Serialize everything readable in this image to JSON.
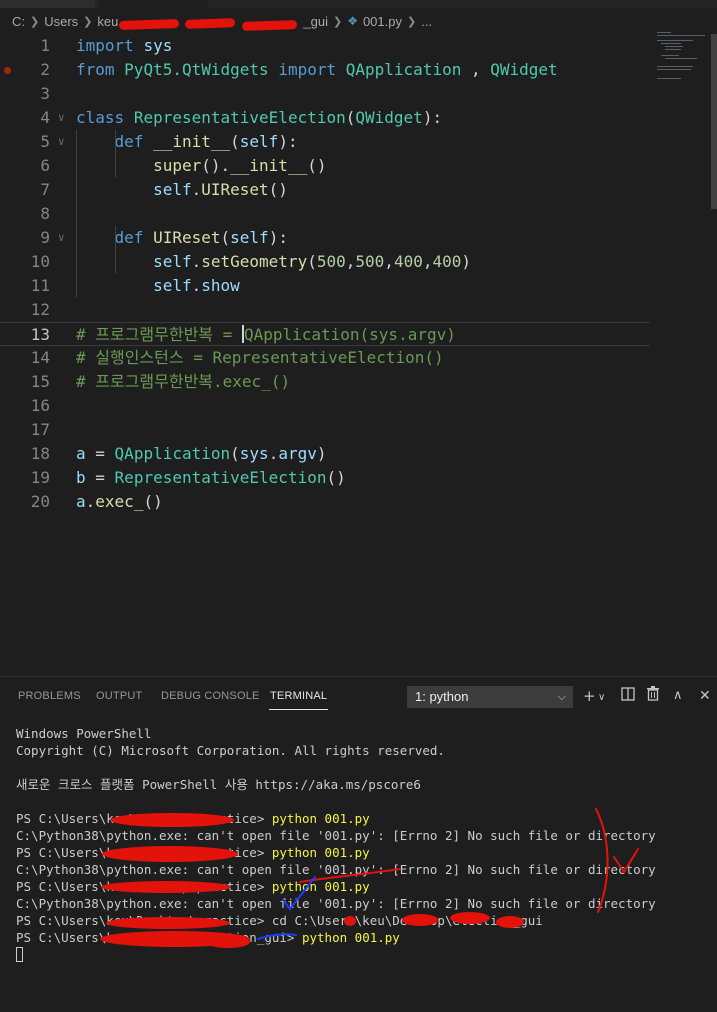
{
  "breadcrumb": {
    "drive": "C:",
    "users": "Users",
    "user": "keu",
    "folder": "_gui",
    "file": "001.py",
    "ellipsis": "..."
  },
  "editor": {
    "lines": [
      {
        "n": "1",
        "tokens": [
          [
            "k",
            "import"
          ],
          [
            "p",
            " "
          ],
          [
            "v",
            "sys"
          ]
        ]
      },
      {
        "n": "2",
        "tokens": [
          [
            "k",
            "from"
          ],
          [
            "p",
            " "
          ],
          [
            "cl",
            "PyQt5.QtWidgets"
          ],
          [
            "p",
            " "
          ],
          [
            "k",
            "import"
          ],
          [
            "p",
            " "
          ],
          [
            "cl",
            "QApplication"
          ],
          [
            "p",
            " , "
          ],
          [
            "cl",
            "QWidget"
          ]
        ]
      },
      {
        "n": "3",
        "tokens": []
      },
      {
        "n": "4",
        "tokens": [
          [
            "k",
            "class"
          ],
          [
            "p",
            " "
          ],
          [
            "cl",
            "RepresentativeElection"
          ],
          [
            "p",
            "("
          ],
          [
            "cl",
            "QWidget"
          ],
          [
            "p",
            "):"
          ]
        ]
      },
      {
        "n": "5",
        "tokens": [
          [
            "p",
            "    "
          ],
          [
            "k",
            "def"
          ],
          [
            "p",
            " "
          ],
          [
            "fn",
            "__init__"
          ],
          [
            "p",
            "("
          ],
          [
            "v",
            "self"
          ],
          [
            "p",
            "):"
          ]
        ]
      },
      {
        "n": "6",
        "tokens": [
          [
            "p",
            "        "
          ],
          [
            "fn",
            "super"
          ],
          [
            "p",
            "()."
          ],
          [
            "fn",
            "__init__"
          ],
          [
            "p",
            "()"
          ]
        ]
      },
      {
        "n": "7",
        "tokens": [
          [
            "p",
            "        "
          ],
          [
            "v",
            "self"
          ],
          [
            "p",
            "."
          ],
          [
            "fn",
            "UIReset"
          ],
          [
            "p",
            "()"
          ]
        ]
      },
      {
        "n": "8",
        "tokens": []
      },
      {
        "n": "9",
        "tokens": [
          [
            "p",
            "    "
          ],
          [
            "k",
            "def"
          ],
          [
            "p",
            " "
          ],
          [
            "fn",
            "UIReset"
          ],
          [
            "p",
            "("
          ],
          [
            "v",
            "self"
          ],
          [
            "p",
            "):"
          ]
        ]
      },
      {
        "n": "10",
        "tokens": [
          [
            "p",
            "        "
          ],
          [
            "v",
            "self"
          ],
          [
            "p",
            "."
          ],
          [
            "fn",
            "setGeometry"
          ],
          [
            "p",
            "("
          ],
          [
            "n",
            "500"
          ],
          [
            "p",
            ","
          ],
          [
            "n",
            "500"
          ],
          [
            "p",
            ","
          ],
          [
            "n",
            "400"
          ],
          [
            "p",
            ","
          ],
          [
            "n",
            "400"
          ],
          [
            "p",
            ")"
          ]
        ]
      },
      {
        "n": "11",
        "tokens": [
          [
            "p",
            "        "
          ],
          [
            "v",
            "self"
          ],
          [
            "p",
            "."
          ],
          [
            "v",
            "show"
          ]
        ]
      },
      {
        "n": "12",
        "tokens": []
      },
      {
        "n": "13",
        "tokens": [
          [
            "cm",
            "# 프로그램무한반복 = "
          ],
          [
            "cursor",
            ""
          ],
          [
            "cm",
            "QApplication(sys.argv)"
          ]
        ]
      },
      {
        "n": "14",
        "tokens": [
          [
            "cm",
            "# 실행인스턴스 = RepresentativeElection()"
          ]
        ]
      },
      {
        "n": "15",
        "tokens": [
          [
            "cm",
            "# 프로그램무한반복.exec_()"
          ]
        ]
      },
      {
        "n": "16",
        "tokens": []
      },
      {
        "n": "17",
        "tokens": []
      },
      {
        "n": "18",
        "tokens": [
          [
            "v",
            "a"
          ],
          [
            "p",
            " = "
          ],
          [
            "cl",
            "QApplication"
          ],
          [
            "p",
            "("
          ],
          [
            "v",
            "sys"
          ],
          [
            "p",
            "."
          ],
          [
            "v",
            "argv"
          ],
          [
            "p",
            ")"
          ]
        ]
      },
      {
        "n": "19",
        "tokens": [
          [
            "v",
            "b"
          ],
          [
            "p",
            " = "
          ],
          [
            "cl",
            "RepresentativeElection"
          ],
          [
            "p",
            "()"
          ]
        ]
      },
      {
        "n": "20",
        "tokens": [
          [
            "v",
            "a"
          ],
          [
            "p",
            "."
          ],
          [
            "fn",
            "exec_"
          ],
          [
            "p",
            "()"
          ]
        ]
      }
    ]
  },
  "panel": {
    "tabs": [
      "PROBLEMS",
      "OUTPUT",
      "DEBUG CONSOLE",
      "TERMINAL"
    ],
    "active_tab": "TERMINAL",
    "terminal_select": "1: python"
  },
  "terminal": {
    "lines": [
      {
        "text": "Windows PowerShell"
      },
      {
        "text": "Copyright (C) Microsoft Corporation. All rights reserved."
      },
      {
        "text": ""
      },
      {
        "text": "새로운 크로스 플랫폼 PowerShell 사용 https://aka.ms/pscore6"
      },
      {
        "text": ""
      },
      {
        "text": "PS C:\\Users\\keu\\Desktop\\practice> ",
        "cmd": "python 001.py"
      },
      {
        "text": "C:\\Python38\\python.exe: can't open file '001.py': [Errno 2] No such file or directory"
      },
      {
        "text": "PS C:\\Users\\keu\\Desktop\\practice> ",
        "cmd": "python 001.py"
      },
      {
        "text": "C:\\Python38\\python.exe: can't open file '001.py': [Errno 2] No such file or directory"
      },
      {
        "text": "PS C:\\Users\\keu\\Desktop\\practice> ",
        "cmd": "python 001.py"
      },
      {
        "text": "C:\\Python38\\python.exe: can't open file '001.py': [Errno 2] No such file or directory"
      },
      {
        "text": "PS C:\\Users\\keu\\Desktop\\practice> cd C:\\Users\\keu\\Desktop\\election_gui"
      },
      {
        "text": "PS C:\\Users\\keu\\Desktop\\election_gui> ",
        "cmd": "python 001.py"
      }
    ]
  },
  "colors": {
    "background": "#1e1e1e",
    "keyword": "#569cd6",
    "class": "#4ec9b0",
    "function": "#dcdcaa",
    "comment": "#6a9955",
    "number": "#b5cea8",
    "command": "#f5f543",
    "annotation_red": "#e3120b",
    "annotation_blue": "#1a3cff"
  }
}
